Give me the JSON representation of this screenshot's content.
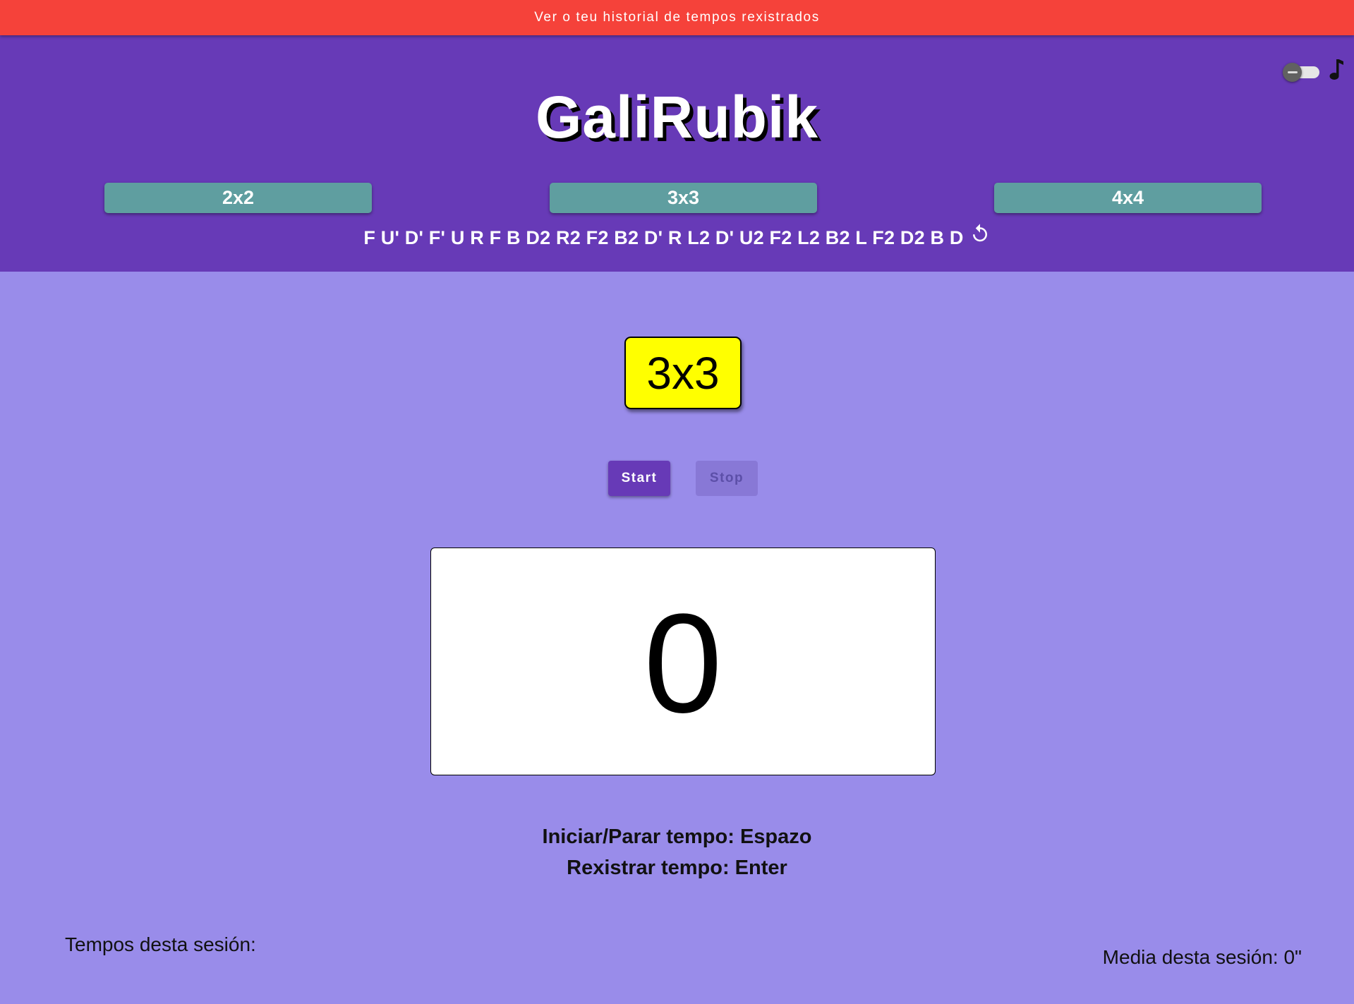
{
  "history_banner": {
    "label": "Ver o teu historial de tempos rexistrados",
    "color": "#f5423a"
  },
  "header": {
    "title": "GaliRubik",
    "background": "#673ab7",
    "theme_toggle": {
      "on": false,
      "icon": "toggle-icon"
    },
    "music_icon": "music-note-icon",
    "cube_sizes": [
      {
        "label": "2x2"
      },
      {
        "label": "3x3"
      },
      {
        "label": "4x4"
      }
    ],
    "scramble": "F U' D' F' U R F B D2 R2 F2 B2 D' R L2 D' U2 F2 L2 B2 L F2 D2 B D",
    "refresh_icon": "refresh-icon"
  },
  "main": {
    "background": "#998cea",
    "selected_cube": "3x3",
    "start_label": "Start",
    "stop_label": "Stop",
    "timer_value": "0",
    "shortcuts": [
      "Iniciar/Parar tempo: Espazo",
      "Rexistrar tempo: Enter"
    ],
    "session_times_label": "Tempos desta sesión:",
    "session_average_label": "Media desta sesión: 0\""
  }
}
